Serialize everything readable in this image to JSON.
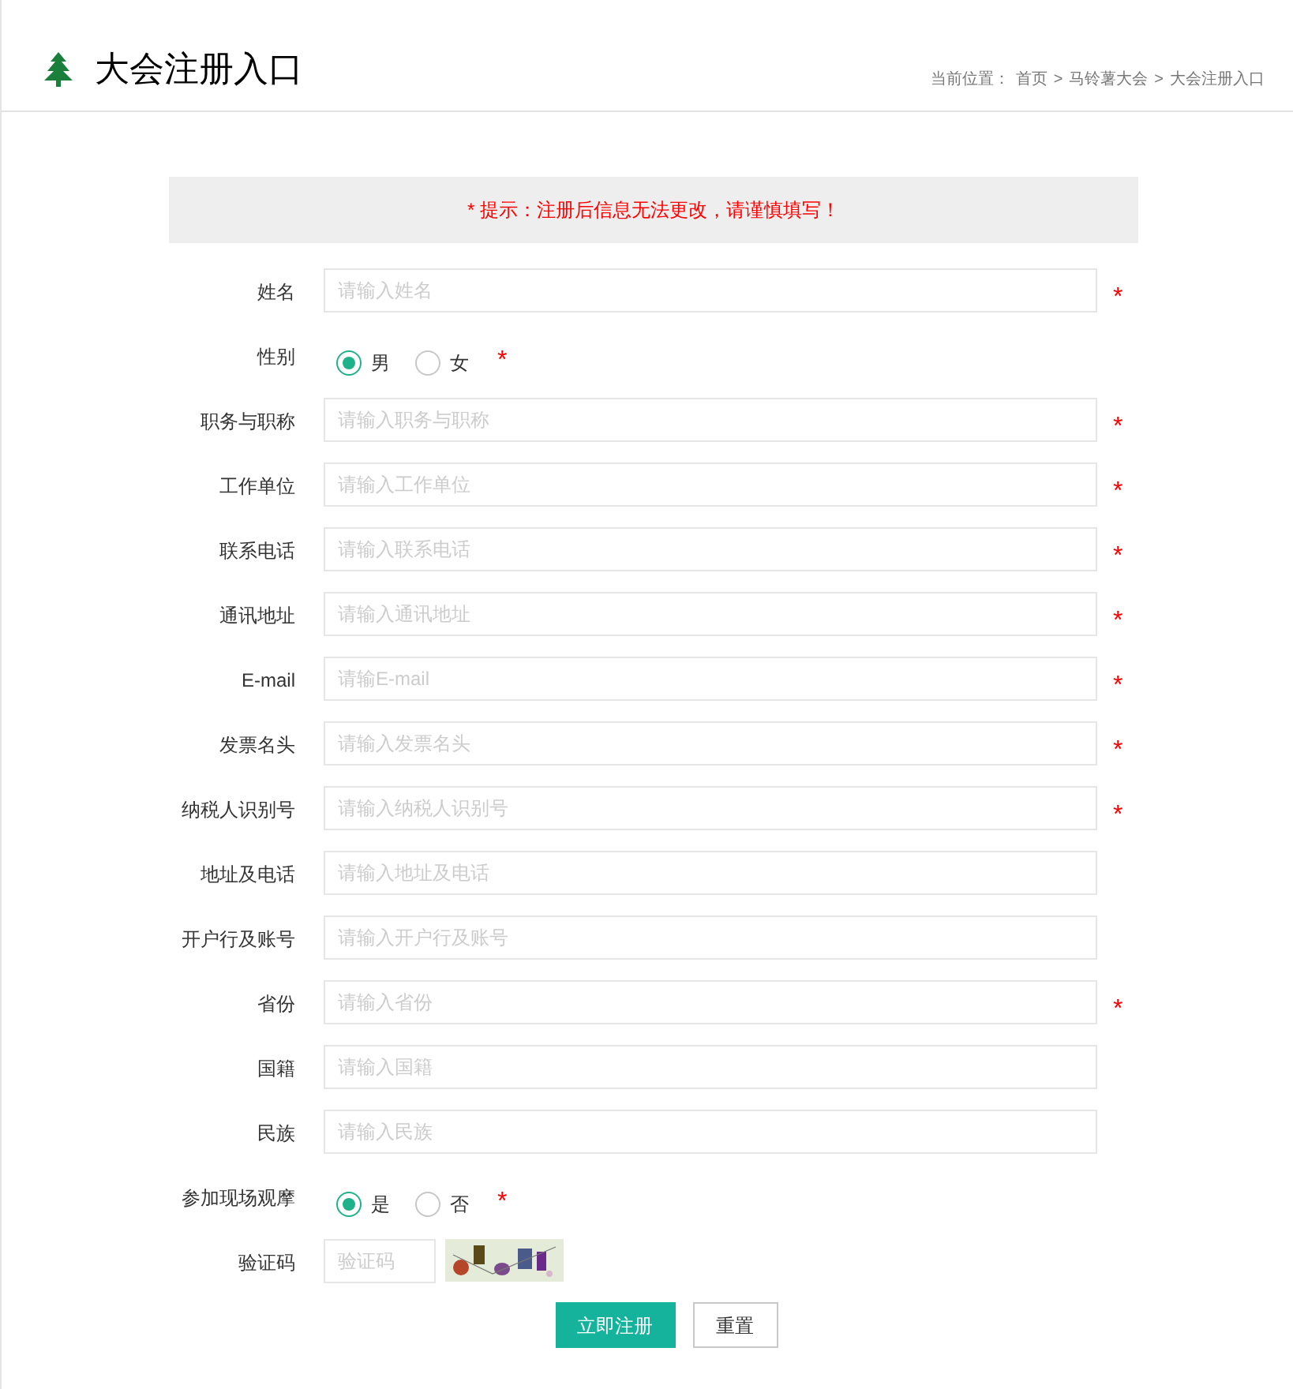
{
  "header": {
    "title": "大会注册入口",
    "breadcrumb": {
      "prefix": "当前位置：",
      "items": [
        "首页",
        "马铃薯大会",
        "大会注册入口"
      ],
      "separator": ">"
    }
  },
  "notice": "* 提示：注册后信息无法更改，请谨慎填写！",
  "fields": [
    {
      "kind": "text",
      "label": "姓名",
      "placeholder": "请输入姓名",
      "required": true
    },
    {
      "kind": "radio",
      "label": "性别",
      "required": true,
      "options": [
        {
          "label": "男",
          "selected": true
        },
        {
          "label": "女",
          "selected": false
        }
      ]
    },
    {
      "kind": "text",
      "label": "职务与职称",
      "placeholder": "请输入职务与职称",
      "required": true
    },
    {
      "kind": "text",
      "label": "工作单位",
      "placeholder": "请输入工作单位",
      "required": true
    },
    {
      "kind": "text",
      "label": "联系电话",
      "placeholder": "请输入联系电话",
      "required": true
    },
    {
      "kind": "text",
      "label": "通讯地址",
      "placeholder": "请输入通讯地址",
      "required": true
    },
    {
      "kind": "text",
      "label": "E-mail",
      "placeholder": "请输E-mail",
      "required": true
    },
    {
      "kind": "text",
      "label": "发票名头",
      "placeholder": "请输入发票名头",
      "required": true
    },
    {
      "kind": "text",
      "label": "纳税人识别号",
      "placeholder": "请输入纳税人识别号",
      "required": true
    },
    {
      "kind": "text",
      "label": "地址及电话",
      "placeholder": "请输入地址及电话",
      "required": false
    },
    {
      "kind": "text",
      "label": "开户行及账号",
      "placeholder": "请输入开户行及账号",
      "required": false
    },
    {
      "kind": "text",
      "label": "省份",
      "placeholder": "请输入省份",
      "required": true
    },
    {
      "kind": "text",
      "label": "国籍",
      "placeholder": "请输入国籍",
      "required": false
    },
    {
      "kind": "text",
      "label": "民族",
      "placeholder": "请输入民族",
      "required": false
    },
    {
      "kind": "radio",
      "label": "参加现场观摩",
      "required": true,
      "options": [
        {
          "label": "是",
          "selected": true
        },
        {
          "label": "否",
          "selected": false
        }
      ]
    },
    {
      "kind": "captcha",
      "label": "验证码",
      "placeholder": "验证码",
      "required": false
    }
  ],
  "required_mark": "*",
  "buttons": {
    "submit": "立即注册",
    "reset": "重置"
  }
}
